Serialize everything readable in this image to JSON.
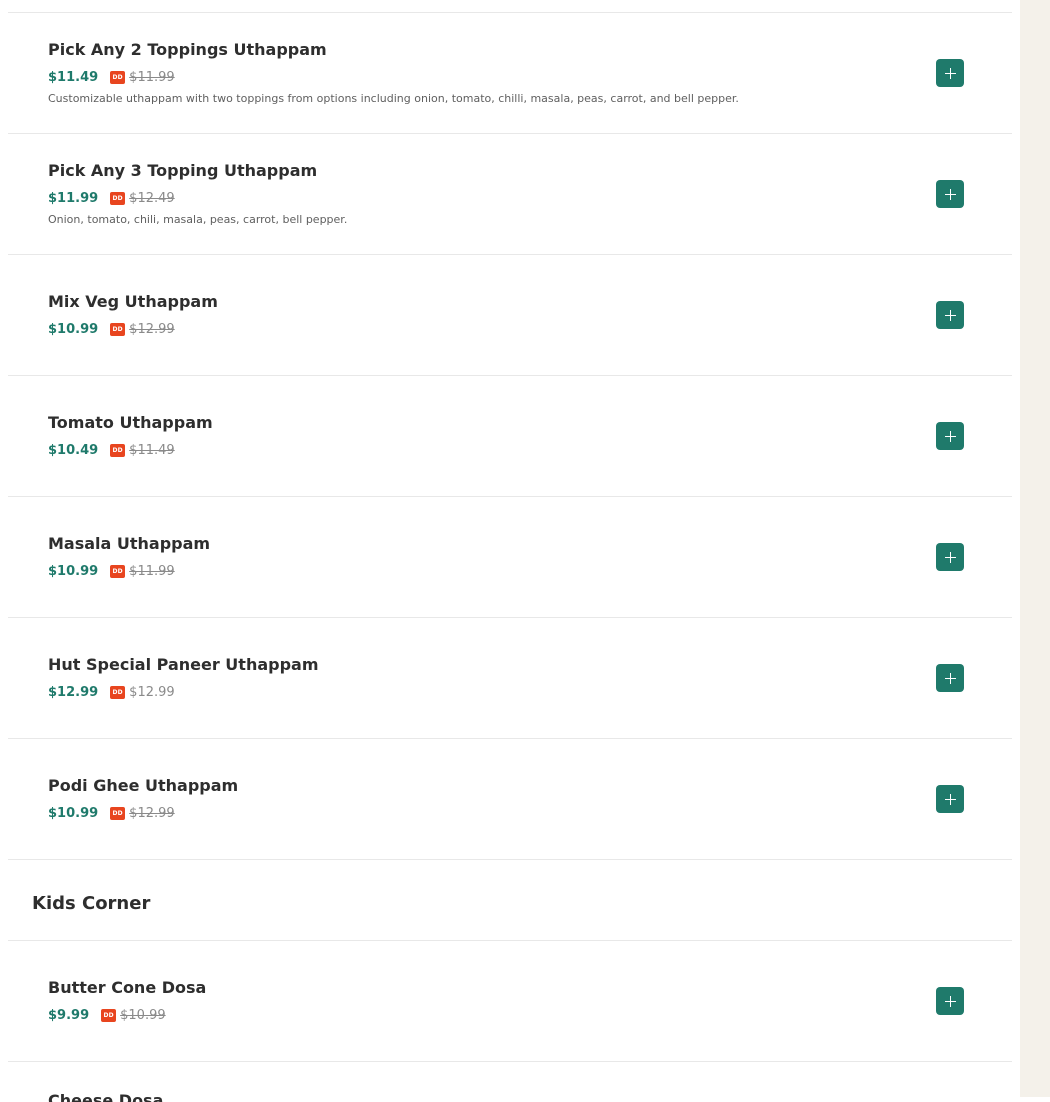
{
  "items_top": [
    {
      "name": "Pick Any 2 Toppings Uthappam",
      "price": "$11.49",
      "badge": "DD",
      "old_price": "$11.99",
      "description": "Customizable uthappam with two toppings from options including onion, tomato, chilli, masala, peas, carrot, and bell pepper."
    },
    {
      "name": "Pick Any 3 Topping Uthappam",
      "price": "$11.99",
      "badge": "DD",
      "old_price": "$12.49",
      "description": "Onion, tomato, chili, masala, peas, carrot, bell pepper."
    },
    {
      "name": "Mix Veg Uthappam",
      "price": "$10.99",
      "badge": "DD",
      "old_price": "$12.99",
      "description": ""
    },
    {
      "name": "Tomato Uthappam",
      "price": "$10.49",
      "badge": "DD",
      "old_price": "$11.49",
      "description": ""
    },
    {
      "name": "Masala Uthappam",
      "price": "$10.99",
      "badge": "DD",
      "old_price": "$11.99",
      "description": ""
    },
    {
      "name": "Hut Special Paneer Uthappam",
      "price": "$12.99",
      "badge": "DD",
      "old_price": "$12.99",
      "description": ""
    },
    {
      "name": "Podi Ghee Uthappam",
      "price": "$10.99",
      "badge": "DD",
      "old_price": "$12.99",
      "description": ""
    }
  ],
  "category": {
    "title": "Kids Corner"
  },
  "items_kids": [
    {
      "name": "Butter Cone Dosa",
      "price": "$9.99",
      "badge": "DD",
      "old_price": "$10.99",
      "description": ""
    },
    {
      "name": "Cheese Dosa"
    }
  ],
  "colors": {
    "accent": "#1f7a6b",
    "badge": "#e8451f",
    "rail": "#f4f1ea"
  },
  "icons": {
    "add": "plus-icon"
  }
}
